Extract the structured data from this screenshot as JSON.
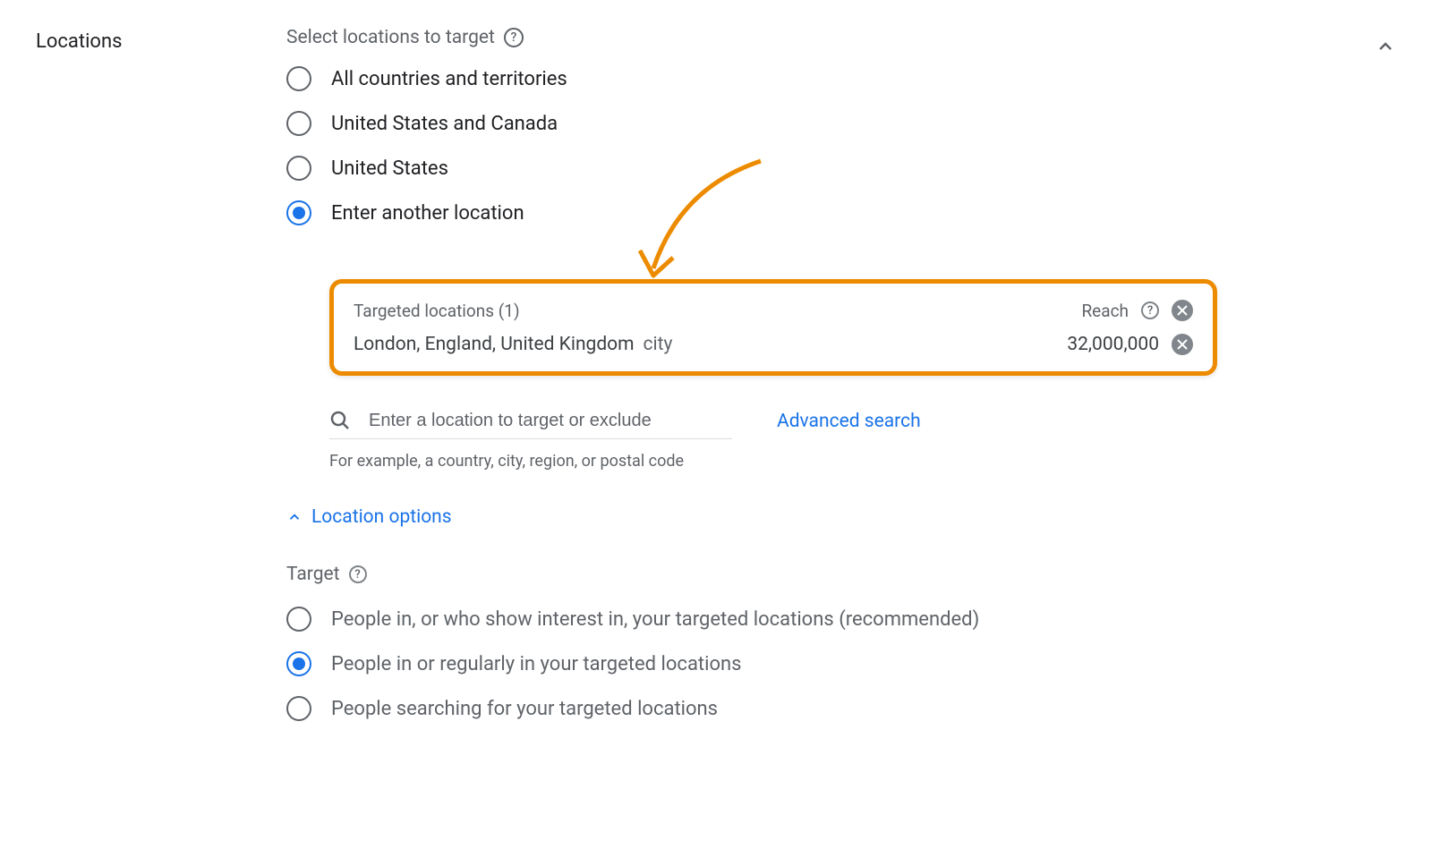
{
  "section_title": "Locations",
  "subheader": "Select locations to target",
  "radio_options": [
    "All countries and territories",
    "United States and Canada",
    "United States",
    "Enter another location"
  ],
  "targeted": {
    "header": "Targeted locations (1)",
    "reach_label": "Reach",
    "location_name": "London, England, United Kingdom",
    "location_type": "city",
    "reach_value": "32,000,000"
  },
  "search": {
    "placeholder": "Enter a location to target or exclude",
    "advanced": "Advanced search",
    "example": "For example, a country, city, region, or postal code"
  },
  "location_options_label": "Location options",
  "target": {
    "header": "Target",
    "options": [
      "People in, or who show interest in, your targeted locations (recommended)",
      "People in or regularly in your targeted locations",
      "People searching for your targeted locations"
    ]
  }
}
